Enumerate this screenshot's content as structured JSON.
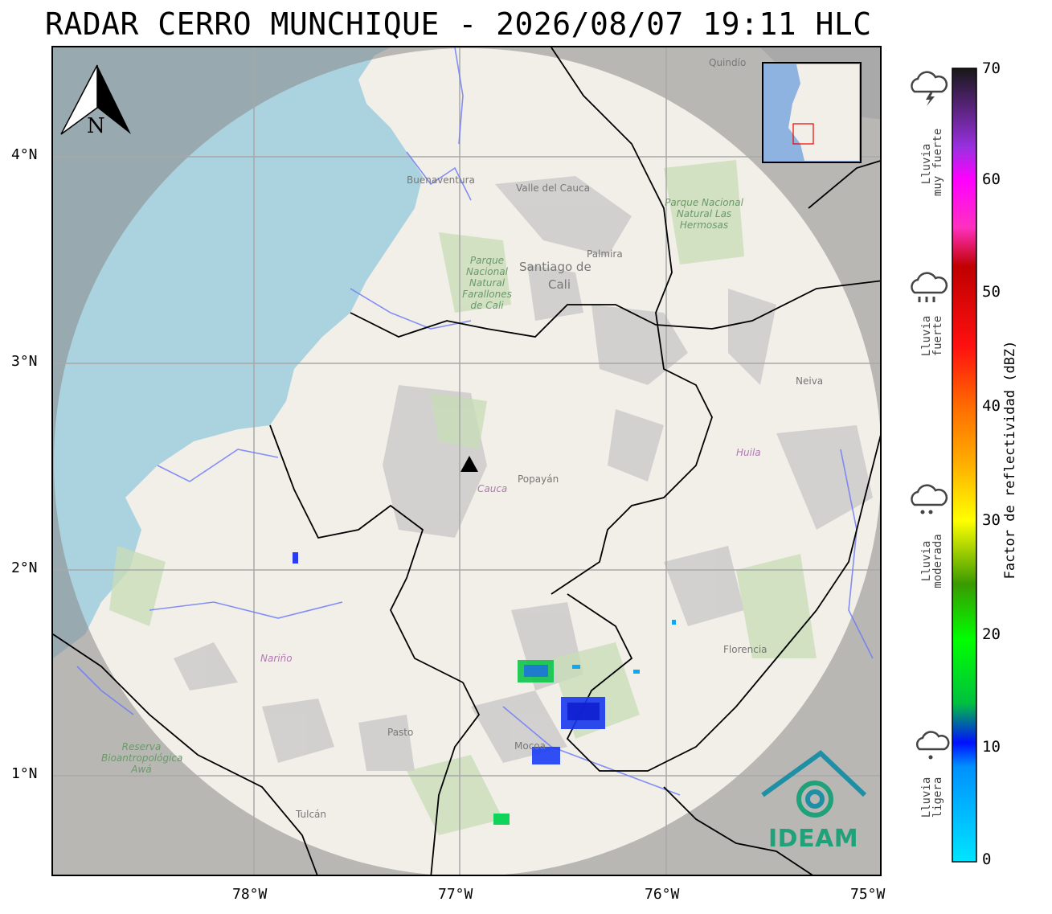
{
  "title": "RADAR CERRO MUNCHIQUE - 2026/08/07 19:11 HLC",
  "lat_ticks": [
    "4°N",
    "3°N",
    "2°N",
    "1°N"
  ],
  "lon_ticks": [
    "78°W",
    "77°W",
    "76°W",
    "75°W"
  ],
  "north_label": "N",
  "colorbar": {
    "title": "Factor de reflectividad (dBZ)",
    "ticks": [
      "70",
      "60",
      "50",
      "40",
      "30",
      "20",
      "10",
      "0"
    ],
    "range": [
      0,
      70
    ]
  },
  "rain_categories": [
    {
      "line1": "Lluvia",
      "line2": "muy fuerte",
      "icon": "thunderstorm-cloud-icon"
    },
    {
      "line1": "Lluvia",
      "line2": "fuerte",
      "icon": "heavy-rain-cloud-icon"
    },
    {
      "line1": "Lluvia",
      "line2": "moderada",
      "icon": "moderate-rain-cloud-icon"
    },
    {
      "line1": "Lluvia",
      "line2": "ligera",
      "icon": "light-rain-cloud-icon"
    }
  ],
  "logo": {
    "text": "IDEAM"
  },
  "places": {
    "buenaventura": "Buenaventura",
    "valle": "Valle del Cauca",
    "palmira": "Palmira",
    "cali_1": "Santiago de",
    "cali_2": "Cali",
    "quindio": "Quindío",
    "popayan": "Popayán",
    "cauca": "Cauca",
    "huila": "Huila",
    "neiva": "Neiva",
    "narino": "Nariño",
    "pasto": "Pasto",
    "mocoa": "Mocoa",
    "florencia": "Florencia",
    "tulcan": "Tulcán",
    "farallones": "Parque Nacional Natural Farallones de Cali",
    "hermosas": "Parque Nacional Natural Las Hermosas",
    "awa": "Reserva Bioantropológica Awá"
  },
  "colors": {
    "sea": "#aad3df",
    "land": "#f2efe9",
    "radar_mask": "#9b9b9b",
    "river": "#6f7cf7",
    "border": "#000000",
    "logo": "#1fa27a"
  }
}
